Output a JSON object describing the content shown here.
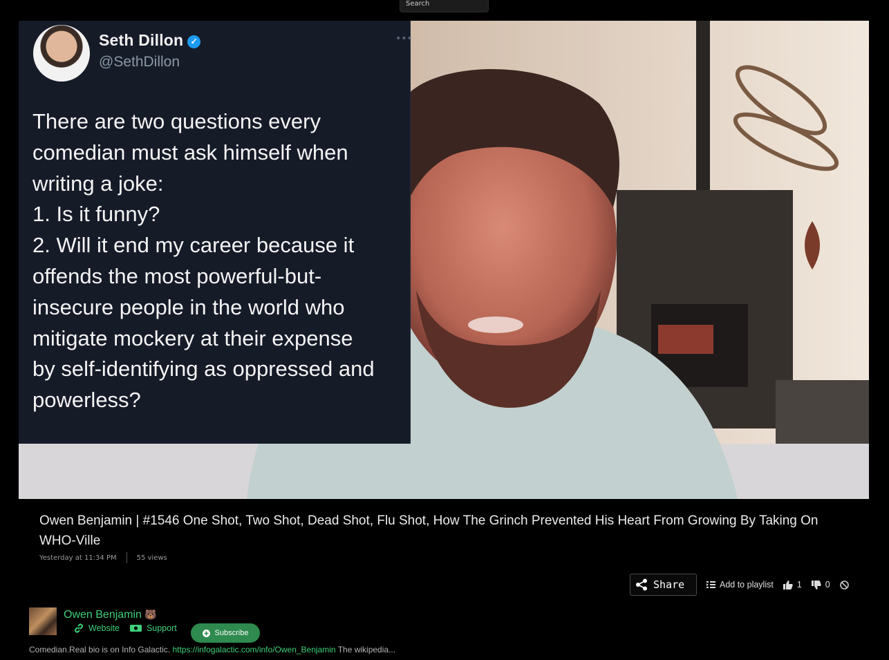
{
  "search": {
    "placeholder": "Search"
  },
  "video": {
    "tweet": {
      "name": "Seth Dillon",
      "handle": "@SethDillon",
      "text": "There are two questions every\ncomedian must ask himself when\nwriting a joke:\n1. Is it funny?\n2. Will it end my career because it\noffends the most powerful-but-\ninsecure people in the world who\nmitigate mockery at their expense\nby self-identifying as oppressed and\npowerless?"
    }
  },
  "title": "Owen Benjamin | #1546 One Shot, Two Shot, Dead Shot, Flu Shot, How The Grinch Prevented His Heart From Growing By Taking On WHO-Ville",
  "meta": {
    "date": "Yesterday at 11:34 PM",
    "views": "55 views"
  },
  "actions": {
    "share": "Share",
    "add_to_playlist": "Add to playlist",
    "likes": "1",
    "dislikes": "0"
  },
  "channel": {
    "name": "Owen Benjamin",
    "website": "Website",
    "support": "Support",
    "subscribe": "Subscribe"
  },
  "description": {
    "before": "Comedian.Real bio is on Info Galactic. ",
    "link": "https://infogalactic.com/info/Owen_Benjamin",
    "after": " The wikipedia..."
  }
}
